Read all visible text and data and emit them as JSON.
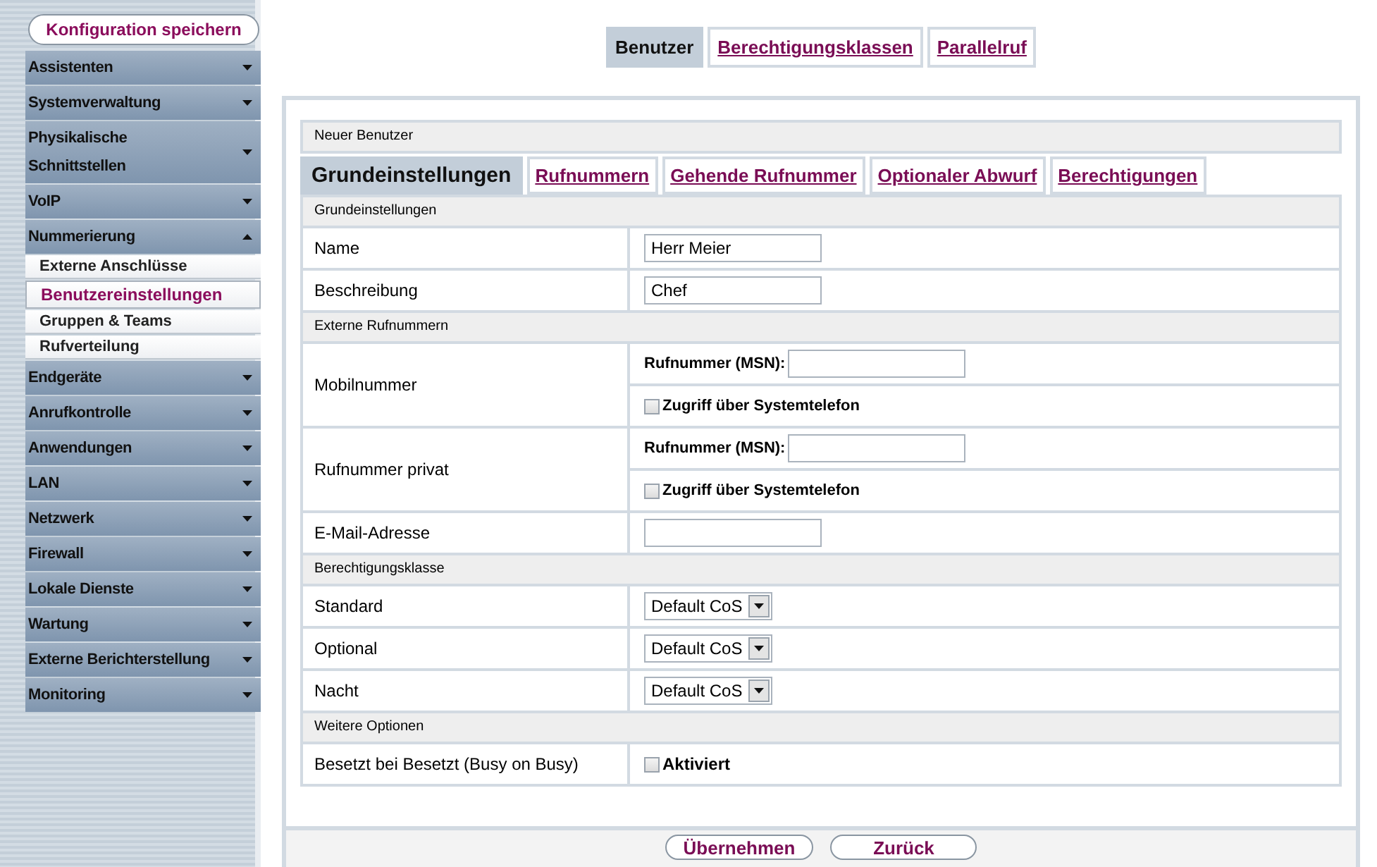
{
  "sidebar": {
    "save_button": "Konfiguration speichern",
    "items": [
      {
        "label": "Assistenten",
        "expanded": false
      },
      {
        "label": "Systemverwaltung",
        "expanded": false
      },
      {
        "label": "Physikalische Schnittstellen",
        "expanded": false
      },
      {
        "label": "VoIP",
        "expanded": false
      },
      {
        "label": "Nummerierung",
        "expanded": true,
        "children": [
          {
            "label": "Externe Anschlüsse",
            "selected": false
          },
          {
            "label": "Benutzereinstellungen",
            "selected": true
          },
          {
            "label": "Gruppen & Teams",
            "selected": false
          },
          {
            "label": "Rufverteilung",
            "selected": false
          }
        ]
      },
      {
        "label": "Endgeräte",
        "expanded": false
      },
      {
        "label": "Anrufkontrolle",
        "expanded": false
      },
      {
        "label": "Anwendungen",
        "expanded": false
      },
      {
        "label": "LAN",
        "expanded": false
      },
      {
        "label": "Netzwerk",
        "expanded": false
      },
      {
        "label": "Firewall",
        "expanded": false
      },
      {
        "label": "Lokale Dienste",
        "expanded": false
      },
      {
        "label": "Wartung",
        "expanded": false
      },
      {
        "label": "Externe Berichterstellung",
        "expanded": false
      },
      {
        "label": "Monitoring",
        "expanded": false
      }
    ]
  },
  "top_tabs": [
    {
      "label": "Benutzer",
      "selected": true
    },
    {
      "label": "Berechtigungsklassen",
      "selected": false
    },
    {
      "label": "Parallelruf",
      "selected": false
    }
  ],
  "panel": {
    "title": "Neuer Benutzer",
    "tabs": [
      {
        "label": "Grundeinstellungen",
        "selected": true
      },
      {
        "label": "Rufnummern",
        "selected": false
      },
      {
        "label": "Gehende Rufnummer",
        "selected": false
      },
      {
        "label": "Optionaler Abwurf",
        "selected": false
      },
      {
        "label": "Berechtigungen",
        "selected": false
      }
    ],
    "sections": [
      {
        "title": "Grundeinstellungen",
        "rows": [
          {
            "kind": "text",
            "label": "Name",
            "value": "Herr Meier"
          },
          {
            "kind": "text",
            "label": "Beschreibung",
            "value": "Chef"
          }
        ]
      },
      {
        "title": "Externe Rufnummern",
        "rows": [
          {
            "kind": "msn",
            "label": "Mobilnummer",
            "msn_label": "Rufnummer (MSN):",
            "checkbox_label": "Zugriff über Systemtelefon",
            "checked": false
          },
          {
            "kind": "msn",
            "label": "Rufnummer privat",
            "msn_label": "Rufnummer (MSN):",
            "checkbox_label": "Zugriff über Systemtelefon",
            "checked": false
          },
          {
            "kind": "text",
            "label": "E-Mail-Adresse"
          }
        ]
      },
      {
        "title": "Berechtigungsklasse",
        "rows": [
          {
            "kind": "select",
            "label": "Standard",
            "value": "Default CoS"
          },
          {
            "kind": "select",
            "label": "Optional",
            "value": "Default CoS"
          },
          {
            "kind": "select",
            "label": "Nacht",
            "value": "Default CoS"
          }
        ]
      },
      {
        "title": "Weitere Optionen",
        "rows": [
          {
            "kind": "checkbox",
            "label": "Besetzt bei Besetzt (Busy on Busy)",
            "checkbox_label": "Aktiviert",
            "checked": false
          }
        ]
      }
    ]
  },
  "buttons": [
    "Übernehmen",
    "Zurück"
  ]
}
